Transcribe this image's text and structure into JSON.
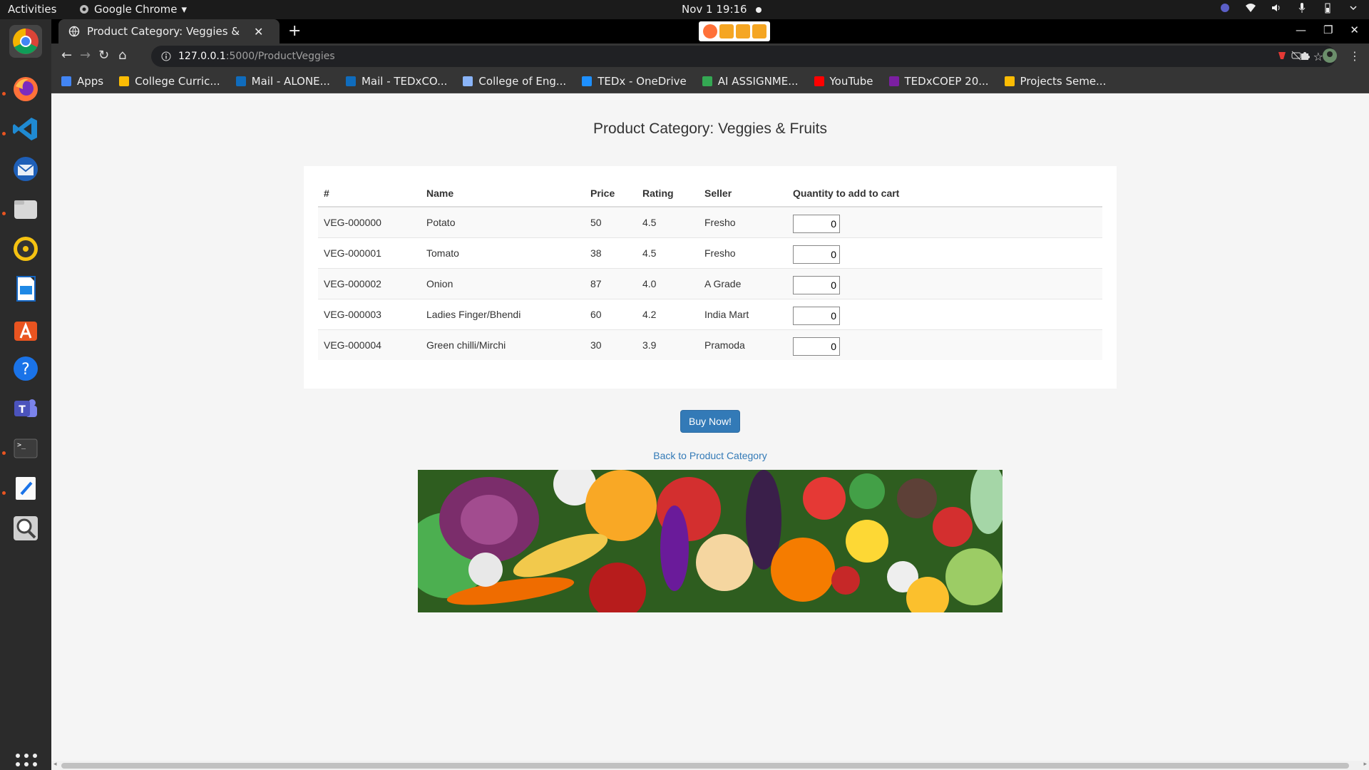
{
  "system": {
    "activities": "Activities",
    "app_menu": "Google Chrome",
    "clock": "Nov 1  19:16"
  },
  "browser": {
    "tab_title": "Product Category: Veggies & Fruits",
    "url_host": "127.0.0.1",
    "url_path": ":5000/ProductVeggies",
    "bookmarks": [
      {
        "label": "Apps",
        "color": "#4285f4"
      },
      {
        "label": "College Curric...",
        "color": "#fbbc04"
      },
      {
        "label": "Mail - ALONE...",
        "color": "#0f6cbd"
      },
      {
        "label": "Mail - TEDxCO...",
        "color": "#0f6cbd"
      },
      {
        "label": "College of Eng...",
        "color": "#8ab4f8"
      },
      {
        "label": "TEDx - OneDrive",
        "color": "#1e90ff"
      },
      {
        "label": "AI ASSIGNME...",
        "color": "#34a853"
      },
      {
        "label": "YouTube",
        "color": "#ff0000"
      },
      {
        "label": "TEDxCOEP 20...",
        "color": "#7b1fa2"
      },
      {
        "label": "Projects Seme...",
        "color": "#fbbc04"
      }
    ]
  },
  "page": {
    "title": "Product Category: Veggies & Fruits",
    "columns": [
      "#",
      "Name",
      "Price",
      "Rating",
      "Seller",
      "Quantity to add to cart"
    ],
    "rows": [
      {
        "id": "VEG-000000",
        "name": "Potato",
        "price": "50",
        "rating": "4.5",
        "seller": "Fresho",
        "qty": "0"
      },
      {
        "id": "VEG-000001",
        "name": "Tomato",
        "price": "38",
        "rating": "4.5",
        "seller": "Fresho",
        "qty": "0"
      },
      {
        "id": "VEG-000002",
        "name": "Onion",
        "price": "87",
        "rating": "4.0",
        "seller": "A Grade",
        "qty": "0"
      },
      {
        "id": "VEG-000003",
        "name": "Ladies Finger/Bhendi",
        "price": "60",
        "rating": "4.2",
        "seller": "India Mart",
        "qty": "0"
      },
      {
        "id": "VEG-000004",
        "name": "Green chilli/Mirchi",
        "price": "30",
        "rating": "3.9",
        "seller": "Pramoda",
        "qty": "0"
      }
    ],
    "buy_label": "Buy Now!",
    "back_link": "Back to Product Category"
  }
}
